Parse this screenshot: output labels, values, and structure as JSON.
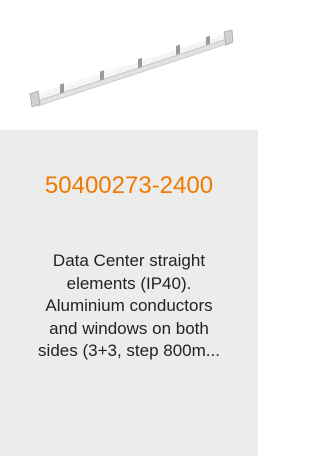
{
  "product": {
    "code": "50400273-2400",
    "description_lines": [
      "Data Center straight",
      "elements (IP40).",
      "Aluminium conductors",
      "and windows on both",
      "sides (3+3, step 800m..."
    ],
    "image_icon": "busbar-straight-element-icon"
  },
  "colors": {
    "code": "#f07a00",
    "card_background": "#ececec",
    "image_background": "#ffffff"
  }
}
